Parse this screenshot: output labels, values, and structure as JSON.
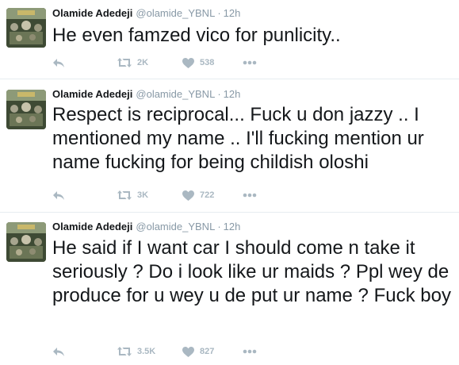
{
  "tweets": [
    {
      "name": "Olamide Adedeji",
      "handle": "@olamide_YBNL",
      "dot": "·",
      "time": "12h",
      "text": "He even famzed vico for punlicity..",
      "retweets": "2K",
      "likes": "538",
      "icons": [
        "reply-icon",
        "retweet-icon",
        "heart-icon",
        "more-icon"
      ]
    },
    {
      "name": "Olamide Adedeji",
      "handle": "@olamide_YBNL",
      "dot": "·",
      "time": "12h",
      "text": "Respect is reciprocal... Fuck u don jazzy .. I mentioned my name .. I'll fucking mention ur name fucking for being childish oloshi",
      "retweets": "3K",
      "likes": "722",
      "icons": [
        "reply-icon",
        "retweet-icon",
        "heart-icon",
        "more-icon"
      ]
    },
    {
      "name": "Olamide Adedeji",
      "handle": "@olamide_YBNL",
      "dot": "·",
      "time": "12h",
      "text": "He said if I want car I should come n take it seriously ? Do i look like ur maids ? Ppl wey de produce for u wey u de put ur name ? Fuck boy",
      "retweets": "3.5K",
      "likes": "827",
      "icons": [
        "reply-icon",
        "retweet-icon",
        "heart-icon",
        "more-icon"
      ]
    }
  ],
  "colors": {
    "text": "#14171a",
    "muted": "#8899a6",
    "action": "#aab8c2",
    "divider": "#e6ecf0"
  }
}
